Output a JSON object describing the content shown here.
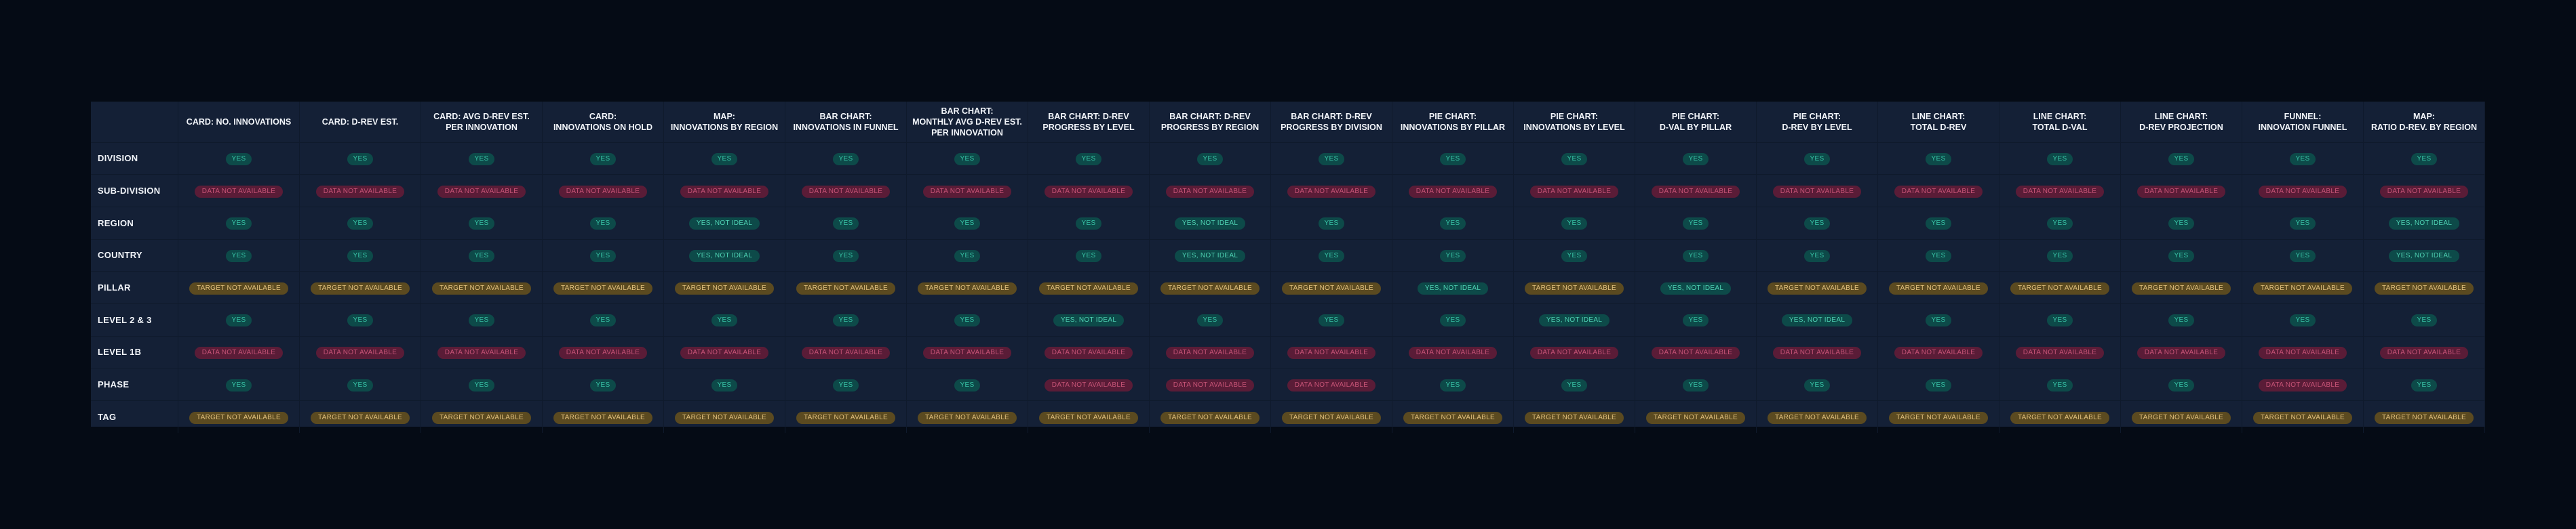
{
  "statuses": {
    "yes": "YES",
    "notideal": "YES, NOT IDEAL",
    "dna": "DATA NOT AVAILABLE",
    "tna": "TARGET NOT AVAILABLE"
  },
  "columns": [
    "CARD: NO. INNOVATIONS",
    "CARD: D-REV EST.",
    "CARD: AVG D-REV EST.\nPER INNOVATION",
    "CARD:\nINNOVATIONS ON HOLD",
    "MAP:\nINNOVATIONS BY REGION",
    "BAR CHART:\nINNOVATIONS IN FUNNEL",
    "BAR CHART:\nMONTHLY AVG D-REV EST.\nPER INNOVATION",
    "BAR CHART: D-REV\nPROGRESS BY LEVEL",
    "BAR CHART: D-REV\nPROGRESS BY REGION",
    "BAR CHART: D-REV\nPROGRESS BY DIVISION",
    "PIE CHART:\nINNOVATIONS BY PILLAR",
    "PIE CHART:\nINNOVATIONS BY LEVEL",
    "PIE CHART:\nD-VAL BY PILLAR",
    "PIE CHART:\nD-REV BY LEVEL",
    "LINE CHART:\nTOTAL D-REV",
    "LINE CHART:\nTOTAL D-VAL",
    "LINE CHART:\nD-REV PROJECTION",
    "FUNNEL:\nINNOVATION FUNNEL",
    "MAP:\nRATIO D-REV. BY REGION"
  ],
  "rows": [
    {
      "label": "DIVISION",
      "cells": [
        "yes",
        "yes",
        "yes",
        "yes",
        "yes",
        "yes",
        "yes",
        "yes",
        "yes",
        "yes",
        "yes",
        "yes",
        "yes",
        "yes",
        "yes",
        "yes",
        "yes",
        "yes",
        "yes"
      ]
    },
    {
      "label": "SUB-DIVISION",
      "cells": [
        "dna",
        "dna",
        "dna",
        "dna",
        "dna",
        "dna",
        "dna",
        "dna",
        "dna",
        "dna",
        "dna",
        "dna",
        "dna",
        "dna",
        "dna",
        "dna",
        "dna",
        "dna",
        "dna"
      ]
    },
    {
      "label": "REGION",
      "cells": [
        "yes",
        "yes",
        "yes",
        "yes",
        "notideal",
        "yes",
        "yes",
        "yes",
        "notideal",
        "yes",
        "yes",
        "yes",
        "yes",
        "yes",
        "yes",
        "yes",
        "yes",
        "yes",
        "notideal"
      ]
    },
    {
      "label": "COUNTRY",
      "cells": [
        "yes",
        "yes",
        "yes",
        "yes",
        "notideal",
        "yes",
        "yes",
        "yes",
        "notideal",
        "yes",
        "yes",
        "yes",
        "yes",
        "yes",
        "yes",
        "yes",
        "yes",
        "yes",
        "notideal"
      ]
    },
    {
      "label": "PILLAR",
      "cells": [
        "tna",
        "tna",
        "tna",
        "tna",
        "tna",
        "tna",
        "tna",
        "tna",
        "tna",
        "tna",
        "notideal",
        "tna",
        "notideal",
        "tna",
        "tna",
        "tna",
        "tna",
        "tna",
        "tna"
      ]
    },
    {
      "label": "LEVEL 2 & 3",
      "cells": [
        "yes",
        "yes",
        "yes",
        "yes",
        "yes",
        "yes",
        "yes",
        "notideal",
        "yes",
        "yes",
        "yes",
        "notideal",
        "yes",
        "notideal",
        "yes",
        "yes",
        "yes",
        "yes",
        "yes"
      ]
    },
    {
      "label": "LEVEL 1B",
      "cells": [
        "dna",
        "dna",
        "dna",
        "dna",
        "dna",
        "dna",
        "dna",
        "dna",
        "dna",
        "dna",
        "dna",
        "dna",
        "dna",
        "dna",
        "dna",
        "dna",
        "dna",
        "dna",
        "dna"
      ]
    },
    {
      "label": "PHASE",
      "cells": [
        "yes",
        "yes",
        "yes",
        "yes",
        "yes",
        "yes",
        "yes",
        "dna",
        "dna",
        "dna",
        "yes",
        "yes",
        "yes",
        "yes",
        "yes",
        "yes",
        "yes",
        "dna",
        "yes"
      ]
    },
    {
      "label": "TAG",
      "cells": [
        "tna",
        "tna",
        "tna",
        "tna",
        "tna",
        "tna",
        "tna",
        "tna",
        "tna",
        "tna",
        "tna",
        "tna",
        "tna",
        "tna",
        "tna",
        "tna",
        "tna",
        "tna",
        "tna"
      ]
    }
  ]
}
